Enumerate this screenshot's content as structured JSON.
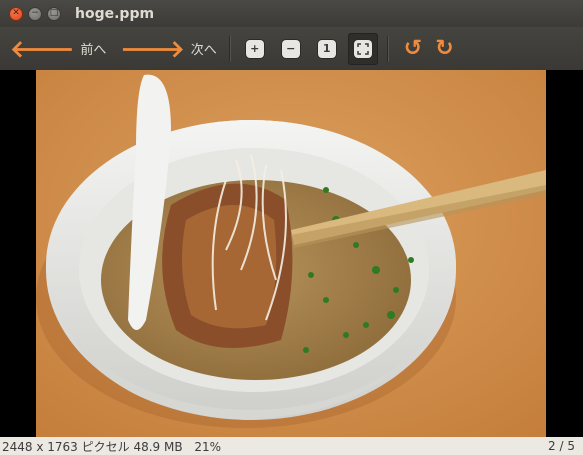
{
  "window": {
    "title": "hoge.ppm",
    "close_glyph": "✕",
    "minimize_glyph": "−",
    "maximize_glyph": "□"
  },
  "toolbar": {
    "prev_label": "前へ",
    "next_label": "次へ",
    "icons": {
      "prev": "arrow-left-icon",
      "next": "arrow-right-icon",
      "zoom_in": "zoom-in-icon",
      "zoom_out": "zoom-out-icon",
      "normal_size": "normal-size-icon",
      "best_fit": "best-fit-icon",
      "rotate_left": "rotate-left-icon",
      "rotate_right": "rotate-right-icon"
    }
  },
  "image": {
    "description_icon": "photo-ramen-bowl"
  },
  "status": {
    "dimensions": "2448 x 1763 ピクセル",
    "size": "48.9 MB",
    "zoom": "21%",
    "position": "2 / 5"
  },
  "colors": {
    "accent": "#f08a3c",
    "titlebar": "#3c3b37",
    "close": "#e95420",
    "statusbar": "#ece9e3"
  }
}
